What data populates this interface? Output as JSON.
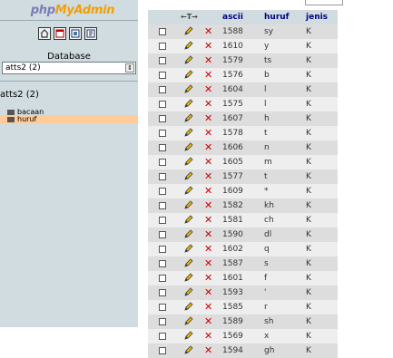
{
  "left": {
    "logo_part1": "php",
    "logo_part2": "MyAdmin",
    "database_label": "Database",
    "database_select": "atts2 (2)",
    "db_name": "atts2 (2)",
    "tables": [
      "bacaan",
      "huruf"
    ],
    "icons": [
      "home-icon",
      "sql-window-icon",
      "query-icon",
      "docs-icon"
    ]
  },
  "grid": {
    "header_arrows": "←T→",
    "columns": [
      "ascii",
      "huruf",
      "jenis"
    ],
    "rows": [
      {
        "ascii": "1588",
        "huruf": "sy",
        "jenis": "K"
      },
      {
        "ascii": "1610",
        "huruf": "y",
        "jenis": "K"
      },
      {
        "ascii": "1579",
        "huruf": "ts",
        "jenis": "K"
      },
      {
        "ascii": "1576",
        "huruf": "b",
        "jenis": "K"
      },
      {
        "ascii": "1604",
        "huruf": "l",
        "jenis": "K"
      },
      {
        "ascii": "1575",
        "huruf": "l",
        "jenis": "K"
      },
      {
        "ascii": "1607",
        "huruf": "h",
        "jenis": "K"
      },
      {
        "ascii": "1578",
        "huruf": "t",
        "jenis": "K"
      },
      {
        "ascii": "1606",
        "huruf": "n",
        "jenis": "K"
      },
      {
        "ascii": "1605",
        "huruf": "m",
        "jenis": "K"
      },
      {
        "ascii": "1577",
        "huruf": "t",
        "jenis": "K"
      },
      {
        "ascii": "1609",
        "huruf": "*",
        "jenis": "K"
      },
      {
        "ascii": "1582",
        "huruf": "kh",
        "jenis": "K"
      },
      {
        "ascii": "1581",
        "huruf": "ch",
        "jenis": "K"
      },
      {
        "ascii": "1590",
        "huruf": "dl",
        "jenis": "K"
      },
      {
        "ascii": "1602",
        "huruf": "q",
        "jenis": "K"
      },
      {
        "ascii": "1587",
        "huruf": "s",
        "jenis": "K"
      },
      {
        "ascii": "1601",
        "huruf": "f",
        "jenis": "K"
      },
      {
        "ascii": "1593",
        "huruf": "'",
        "jenis": "K"
      },
      {
        "ascii": "1585",
        "huruf": "r",
        "jenis": "K"
      },
      {
        "ascii": "1589",
        "huruf": "sh",
        "jenis": "K"
      },
      {
        "ascii": "1569",
        "huruf": "x",
        "jenis": "K"
      },
      {
        "ascii": "1594",
        "huruf": "gh",
        "jenis": "K"
      }
    ]
  },
  "colors": {
    "left_bg": "#d0dce0",
    "header_bg": "#d0dce0",
    "row_even": "#dddddd",
    "row_odd": "#eeeeee",
    "selected_table_bg": "#ffcc99",
    "delete_red": "#cc0000",
    "header_text": "#000080"
  }
}
